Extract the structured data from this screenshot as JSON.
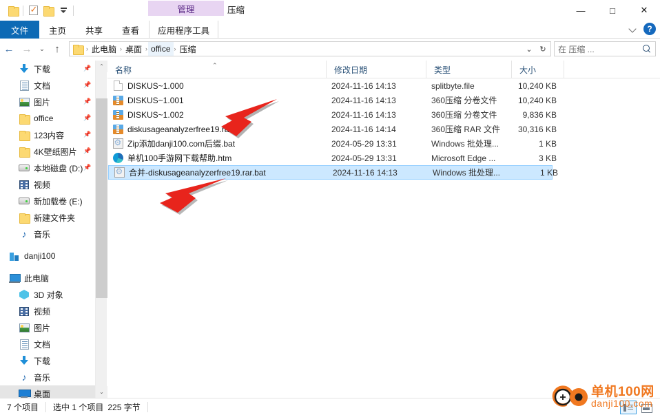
{
  "window": {
    "title": "压缩",
    "contextual_tab_header": "管理",
    "minimize_label": "—",
    "maximize_label": "□",
    "close_label": "✕"
  },
  "quick_access_toolbar": {
    "items": [
      {
        "name": "properties-folder-icon",
        "icon": "folder-icon"
      },
      {
        "name": "new-folder-check-icon",
        "icon": "check-icon"
      },
      {
        "name": "folder-icon",
        "icon": "folder-icon"
      },
      {
        "name": "customize-dropdown-icon",
        "icon": "chevron-down-icon"
      }
    ]
  },
  "ribbon": {
    "tabs": [
      {
        "label": "文件",
        "active": false,
        "style": "file"
      },
      {
        "label": "主页",
        "active": false,
        "style": "normal"
      },
      {
        "label": "共享",
        "active": false,
        "style": "normal"
      },
      {
        "label": "查看",
        "active": false,
        "style": "normal"
      },
      {
        "label": "应用程序工具",
        "active": true,
        "style": "contextual"
      }
    ],
    "collapse_icon": "chevron-down-icon",
    "help_label": "?"
  },
  "address_bar": {
    "back_label": "←",
    "forward_label": "→",
    "recent_label": "⌄",
    "up_label": "↑",
    "crumbs": [
      {
        "label": "此电脑",
        "active": false
      },
      {
        "label": "桌面",
        "active": false
      },
      {
        "label": "office",
        "active": false
      },
      {
        "label": "压缩",
        "active": true
      }
    ],
    "separator": "›",
    "dropdown_label": "⌄",
    "refresh_label": "↻"
  },
  "search": {
    "placeholder": "在 压缩 ...",
    "icon": "search-icon"
  },
  "sidebar": {
    "quick_access": [
      {
        "label": "下载",
        "icon": "download-icon",
        "pinned": true,
        "level": 1
      },
      {
        "label": "文档",
        "icon": "documents-icon",
        "pinned": true,
        "level": 1
      },
      {
        "label": "图片",
        "icon": "pictures-icon",
        "pinned": true,
        "level": 1
      },
      {
        "label": "office",
        "icon": "folder-icon",
        "pinned": true,
        "level": 1
      },
      {
        "label": "123内容",
        "icon": "folder-icon",
        "pinned": true,
        "level": 1
      },
      {
        "label": "4K壁纸图片",
        "icon": "folder-icon",
        "pinned": true,
        "level": 1
      },
      {
        "label": "本地磁盘 (D:)",
        "icon": "drive-icon",
        "pinned": true,
        "level": 1
      },
      {
        "label": "视频",
        "icon": "video-icon",
        "pinned": false,
        "level": 1
      },
      {
        "label": "新加载卷 (E:)",
        "icon": "drive-icon",
        "pinned": false,
        "level": 1
      },
      {
        "label": "新建文件夹",
        "icon": "folder-icon",
        "pinned": false,
        "level": 1
      },
      {
        "label": "音乐",
        "icon": "music-icon",
        "pinned": false,
        "level": 1
      }
    ],
    "cloud": [
      {
        "label": "danji100",
        "icon": "cloud-icon",
        "level": 0
      }
    ],
    "this_pc": {
      "label": "此电脑",
      "icon": "pc-icon",
      "children": [
        {
          "label": "3D 对象",
          "icon": "3d-objects-icon",
          "selected": false
        },
        {
          "label": "视频",
          "icon": "video-icon",
          "selected": false
        },
        {
          "label": "图片",
          "icon": "pictures-icon",
          "selected": false
        },
        {
          "label": "文档",
          "icon": "documents-icon",
          "selected": false
        },
        {
          "label": "下载",
          "icon": "download-icon",
          "selected": false
        },
        {
          "label": "音乐",
          "icon": "music-icon",
          "selected": false
        },
        {
          "label": "桌面",
          "icon": "desktop-icon",
          "selected": true
        }
      ]
    },
    "scrollbar": {
      "up_label": "⌃",
      "down_label": "⌄"
    }
  },
  "file_list": {
    "columns": [
      {
        "label": "名称",
        "sorted": "asc",
        "sort_caret": "⌃"
      },
      {
        "label": "修改日期",
        "sorted": ""
      },
      {
        "label": "类型",
        "sorted": ""
      },
      {
        "label": "大小",
        "sorted": ""
      }
    ],
    "rows": [
      {
        "name": "DISKUS~1.000",
        "date": "2024-11-16 14:13",
        "type": "splitbyte.file",
        "size": "10,240 KB",
        "icon": "blank-file-icon",
        "selected": false
      },
      {
        "name": "DISKUS~1.001",
        "date": "2024-11-16 14:13",
        "type": "360压缩 分卷文件",
        "size": "10,240 KB",
        "icon": "archive-icon",
        "selected": false
      },
      {
        "name": "DISKUS~1.002",
        "date": "2024-11-16 14:13",
        "type": "360压缩 分卷文件",
        "size": "9,836 KB",
        "icon": "archive-icon",
        "selected": false
      },
      {
        "name": "diskusageanalyzerfree19.rar",
        "date": "2024-11-16 14:14",
        "type": "360压缩 RAR 文件",
        "size": "30,316 KB",
        "icon": "archive-icon",
        "selected": false
      },
      {
        "name": "Zip添加danji100.com后缀.bat",
        "date": "2024-05-29 13:31",
        "type": "Windows 批处理...",
        "size": "1 KB",
        "icon": "bat-file-icon",
        "selected": false
      },
      {
        "name": "单机100手游网下载帮助.htm",
        "date": "2024-05-29 13:31",
        "type": "Microsoft Edge ...",
        "size": "3 KB",
        "icon": "edge-icon",
        "selected": false
      },
      {
        "name": "合并-diskusageanalyzerfree19.rar.bat",
        "date": "2024-11-16 14:13",
        "type": "Windows 批处理...",
        "size": "1 KB",
        "icon": "bat-file-icon",
        "selected": true
      }
    ]
  },
  "annotations": {
    "arrow_color": "#e8241c",
    "arrows": [
      {
        "name": "annotation-arrow-upper",
        "points_to": "diskusageanalyzerfree19.rar"
      },
      {
        "name": "annotation-arrow-lower",
        "points_to": "合并-diskusageanalyzerfree19.rar.bat"
      }
    ]
  },
  "status_bar": {
    "item_count": "7 个项目",
    "selection": "选中 1 个项目",
    "selection_size": "225 字节",
    "view_details_icon": "details-view-icon",
    "view_large_icon": "large-icons-view-icon"
  },
  "watermark": {
    "line1": "单机100网",
    "line2": "danji100.com",
    "color": "#f07820"
  },
  "colors": {
    "accent": "#0d6ab5",
    "selection": "#cce8ff",
    "contextual_tab": "#e8d5f2",
    "arrow_red": "#e8241c"
  }
}
